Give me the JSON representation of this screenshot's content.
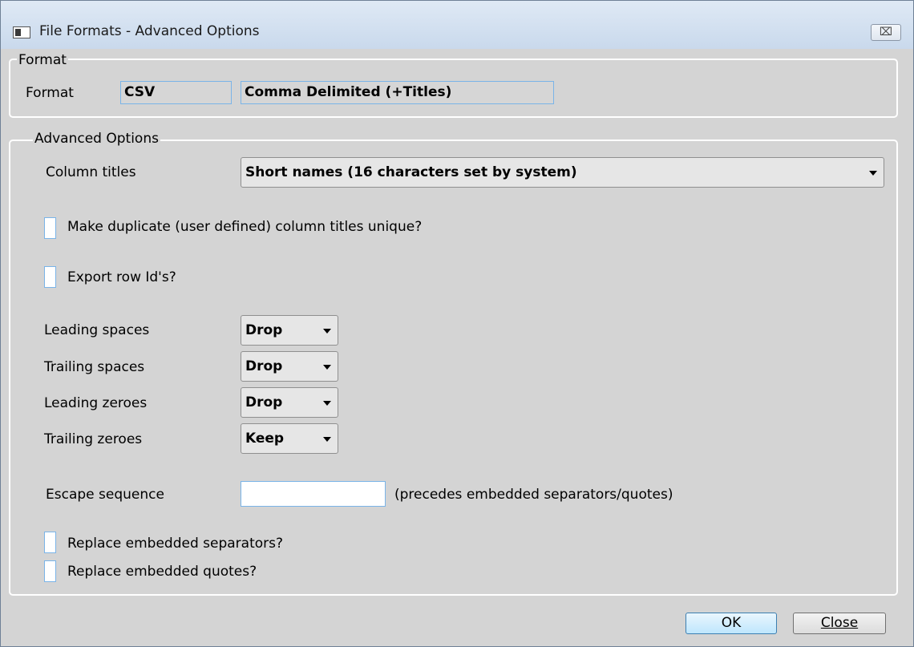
{
  "window": {
    "title": "File Formats - Advanced Options",
    "close_glyph": "⌧"
  },
  "format_group": {
    "title": "Format",
    "label": "Format",
    "code": "CSV",
    "description": "Comma Delimited (+Titles)"
  },
  "advanced_group": {
    "title": "Advanced Options",
    "column_titles": {
      "label": "Column titles",
      "value": "Short names (16 characters set by system)"
    },
    "make_unique": {
      "label": "Make duplicate (user defined) column titles unique?",
      "checked": false
    },
    "export_row_ids": {
      "label": "Export row Id's?",
      "checked": false
    },
    "spaces_zeroes": [
      {
        "label": "Leading spaces",
        "value": "Drop"
      },
      {
        "label": "Trailing spaces",
        "value": "Drop"
      },
      {
        "label": "Leading zeroes",
        "value": "Drop"
      },
      {
        "label": "Trailing zeroes",
        "value": "Keep"
      }
    ],
    "escape_sequence": {
      "label": "Escape sequence",
      "value": "",
      "hint": "(precedes embedded separators/quotes)"
    },
    "replace_separators": {
      "label": "Replace embedded separators?",
      "checked": false
    },
    "replace_quotes": {
      "label": "Replace embedded quotes?",
      "checked": false
    }
  },
  "buttons": {
    "ok": "OK",
    "close": "Close"
  }
}
